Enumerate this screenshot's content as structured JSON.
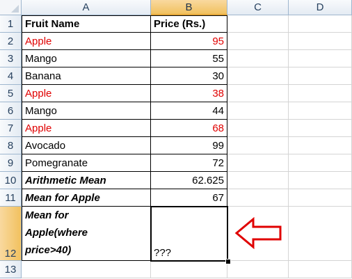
{
  "columns": [
    "A",
    "B",
    "C",
    "D"
  ],
  "rows": [
    "1",
    "2",
    "3",
    "4",
    "5",
    "6",
    "7",
    "8",
    "9",
    "10",
    "11",
    "12",
    "13"
  ],
  "cells": {
    "A1": "Fruit Name",
    "B1": "Price (Rs.)",
    "A2": "Apple",
    "B2": "95",
    "A3": "Mango",
    "B3": "55",
    "A4": "Banana",
    "B4": "30",
    "A5": "Apple",
    "B5": "38",
    "A6": "Mango",
    "B6": "44",
    "A7": "Apple",
    "B7": "68",
    "A8": "Avocado",
    "B8": "99",
    "A9": "Pomegranate",
    "B9": "72",
    "A10": "Arithmetic Mean",
    "B10": "62.625",
    "A11": "Mean for Apple",
    "B11": "67",
    "A12": "Mean for Apple(where price>40)",
    "B12": "???"
  },
  "colors": {
    "apple_text": "#e00000",
    "selected_header": "#f1c15f",
    "arrow": "#e00000"
  },
  "selected_cell": "B12",
  "annotation": "red-outline-arrow"
}
